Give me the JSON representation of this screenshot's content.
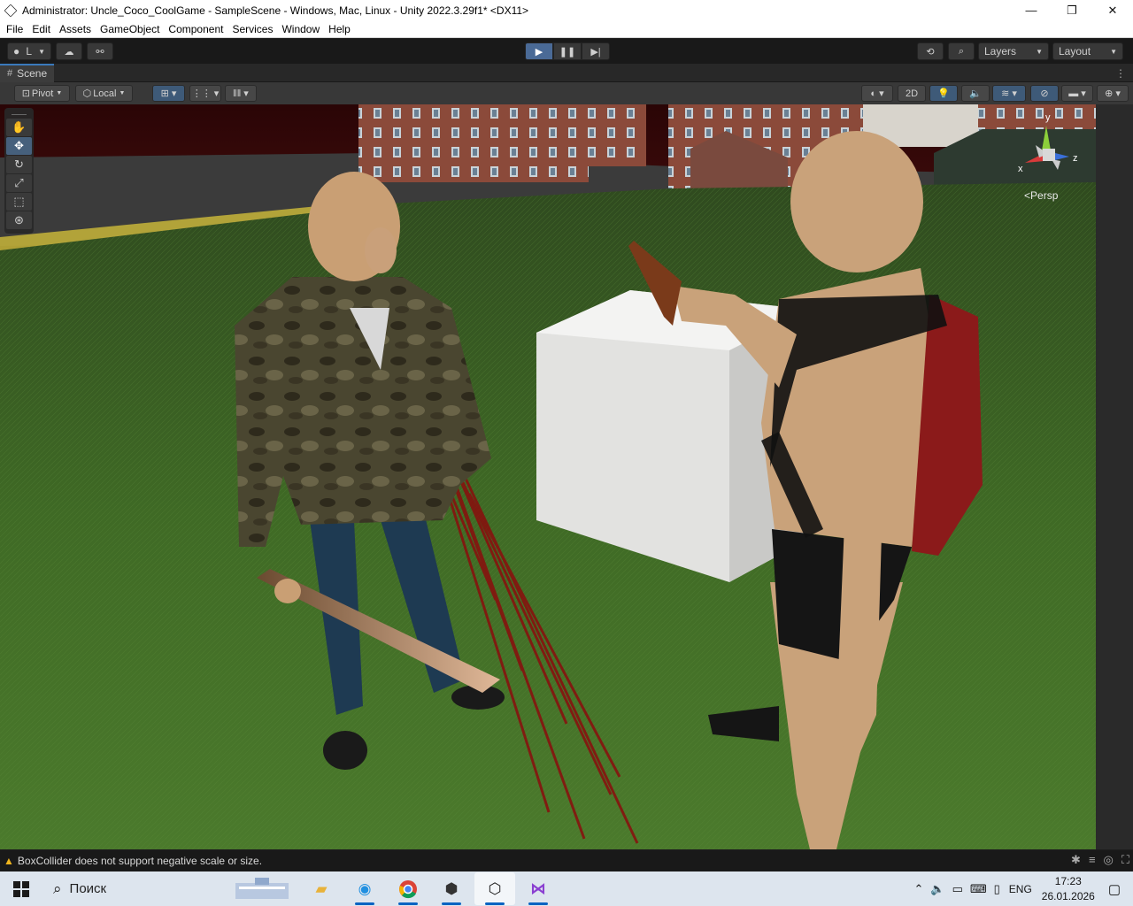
{
  "window": {
    "title": "Administrator: Uncle_Coco_CoolGame - SampleScene - Windows, Mac, Linux - Unity 2022.3.29f1* <DX11>",
    "minimize": "—",
    "maximize": "❐",
    "close": "✕"
  },
  "menu": [
    "File",
    "Edit",
    "Assets",
    "GameObject",
    "Component",
    "Services",
    "Window",
    "Help"
  ],
  "toolbar": {
    "account_label": "L",
    "layers_label": "Layers",
    "layout_label": "Layout"
  },
  "scene_tab": {
    "label": "Scene"
  },
  "scene_tools": {
    "pivot_label": "Pivot",
    "local_label": "Local",
    "mode_2d_label": "2D"
  },
  "gizmo": {
    "axis_y": "y",
    "axis_x": "x",
    "axis_z": "z",
    "projection_label": "Persp"
  },
  "status": {
    "message": "BoxCollider does not support negative scale or size."
  },
  "taskbar": {
    "search_placeholder": "Поиск",
    "language": "ENG",
    "time": "17:23",
    "date": "26.01.2026"
  },
  "colors": {
    "accent": "#3a79bb",
    "play_active": "#4a6a96",
    "warning": "#f0b51e"
  }
}
